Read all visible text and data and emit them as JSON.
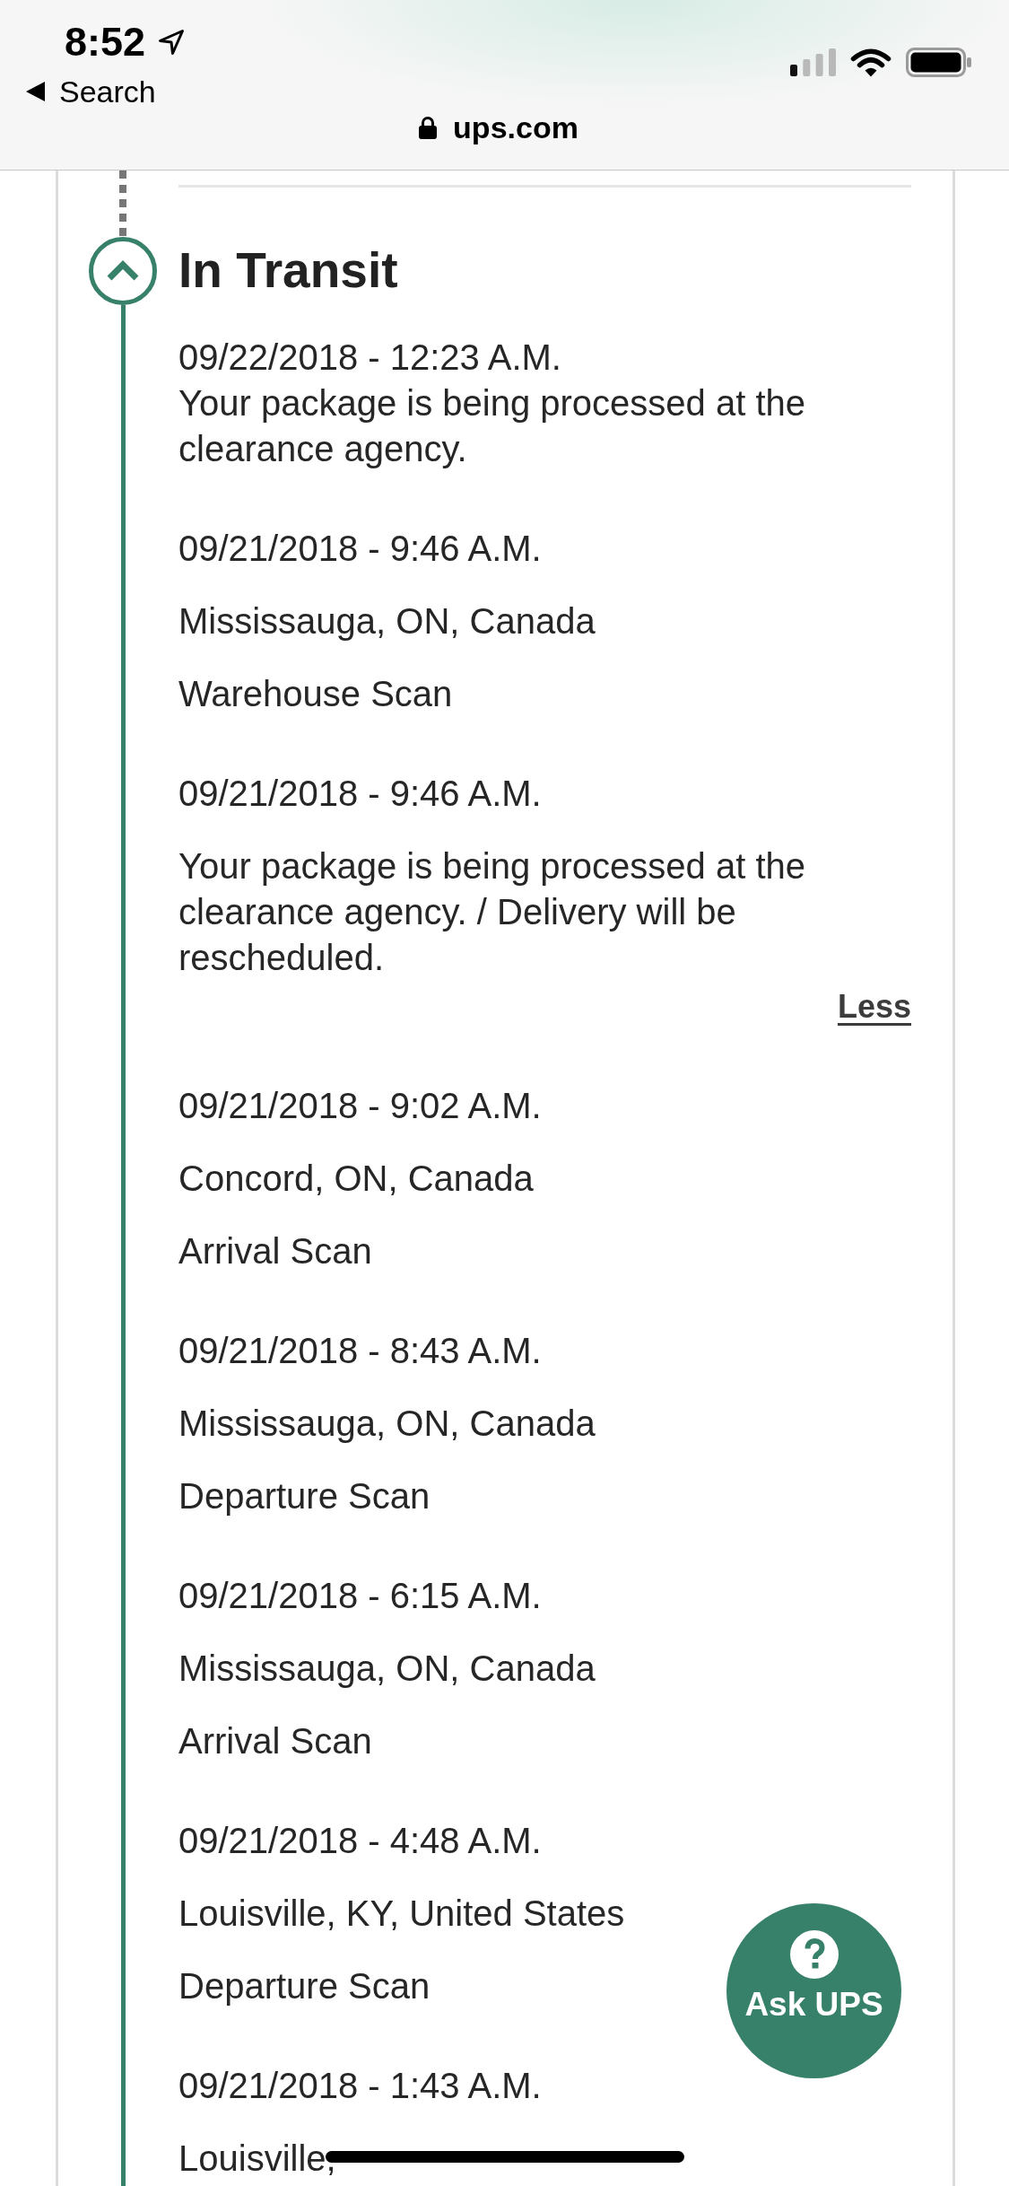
{
  "status_bar": {
    "time": "8:52",
    "back_label": "Search",
    "url": "ups.com"
  },
  "section": {
    "title": "In Transit",
    "expanded": true,
    "events": [
      {
        "kind": "summary",
        "date": "09/22/2018 - 12:23 A.M.",
        "description": "Your package is being processed at the clearance agency."
      },
      {
        "kind": "scan",
        "date": "09/21/2018 - 9:46 A.M.",
        "location": "Mississauga, ON, Canada",
        "activity": "Warehouse Scan"
      },
      {
        "kind": "detail",
        "date": "09/21/2018 - 9:46 A.M.",
        "description": "Your package is being processed at the clearance agency. / Delivery will be rescheduled.",
        "link": "Less"
      },
      {
        "kind": "scan",
        "date": "09/21/2018 - 9:02 A.M.",
        "location": "Concord, ON, Canada",
        "activity": "Arrival Scan"
      },
      {
        "kind": "scan",
        "date": "09/21/2018 - 8:43 A.M.",
        "location": "Mississauga, ON, Canada",
        "activity": "Departure Scan"
      },
      {
        "kind": "scan",
        "date": "09/21/2018 - 6:15 A.M.",
        "location": "Mississauga, ON, Canada",
        "activity": "Arrival Scan"
      },
      {
        "kind": "scan",
        "date": "09/21/2018 - 4:48 A.M.",
        "location": "Louisville, KY, United States",
        "activity": "Departure Scan"
      },
      {
        "kind": "scan",
        "date": "09/21/2018 - 1:43 A.M.",
        "location": "Louisville,"
      }
    ]
  },
  "chat_button": {
    "label": "Ask UPS"
  }
}
